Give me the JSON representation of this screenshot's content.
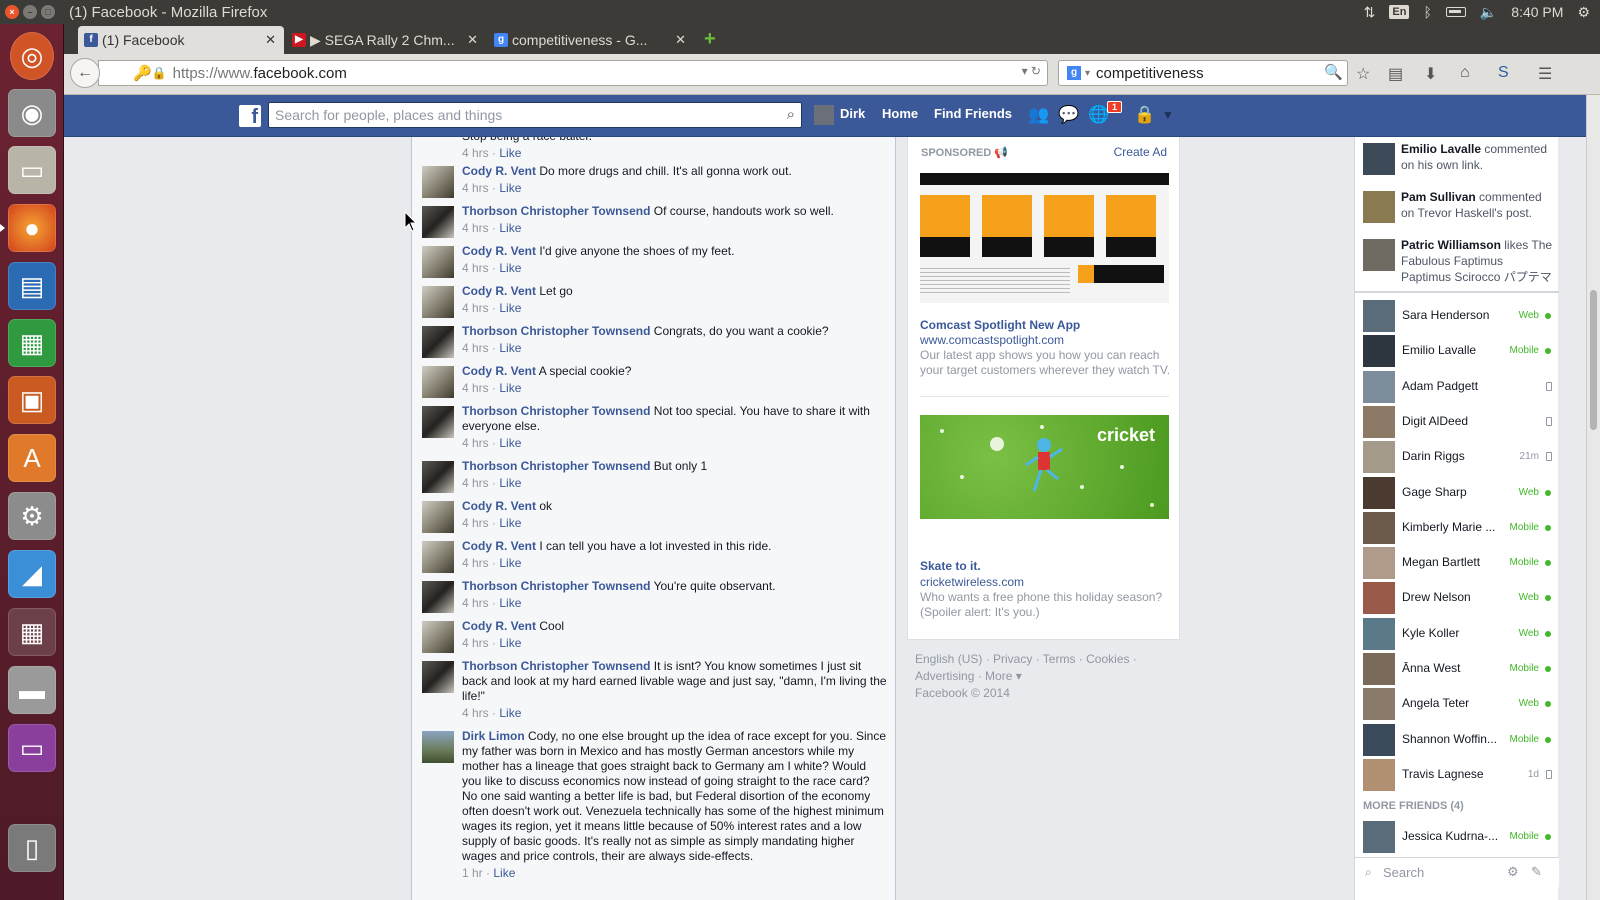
{
  "window": {
    "title": "(1) Facebook - Mozilla Firefox"
  },
  "tray": {
    "keyboard": "En",
    "time": "8:40 PM"
  },
  "tabs": [
    {
      "label": "(1) Facebook",
      "favicon": "facebook-icon",
      "color": "#3b5998"
    },
    {
      "label": "▶ SEGA Rally 2 Chm...",
      "favicon": "youtube-icon",
      "color": "#cc181e"
    },
    {
      "label": "competitiveness - G...",
      "favicon": "google-icon",
      "color": "#4285f4"
    }
  ],
  "navbar": {
    "url_prefix": "https://www.",
    "url_domain": "facebook.com",
    "search_value": "competitiveness"
  },
  "fb_header": {
    "search_placeholder": "Search for people, places and things",
    "user_name": "Dirk",
    "home": "Home",
    "find_friends": "Find Friends",
    "notification_count": "1"
  },
  "comments": [
    {
      "author": "",
      "text": "Stop being a race baiter.",
      "time": "4 hrs",
      "like": "Like",
      "avatar": "none"
    },
    {
      "author": "Cody R. Vent",
      "text": "Do more drugs and chill. It's all gonna work out.",
      "time": "4 hrs",
      "like": "Like",
      "avatar": "cody"
    },
    {
      "author": "Thorbson Christopher Townsend",
      "text": "Of course, handouts work so well.",
      "time": "4 hrs",
      "like": "Like",
      "avatar": "thor"
    },
    {
      "author": "Cody R. Vent",
      "text": "I'd give anyone the shoes of my feet.",
      "time": "4 hrs",
      "like": "Like",
      "avatar": "cody"
    },
    {
      "author": "Cody R. Vent",
      "text": "Let go",
      "time": "4 hrs",
      "like": "Like",
      "avatar": "cody"
    },
    {
      "author": "Thorbson Christopher Townsend",
      "text": "Congrats, do you want a cookie?",
      "time": "4 hrs",
      "like": "Like",
      "avatar": "thor"
    },
    {
      "author": "Cody R. Vent",
      "text": "A special cookie?",
      "time": "4 hrs",
      "like": "Like",
      "avatar": "cody"
    },
    {
      "author": "Thorbson Christopher Townsend",
      "text": "Not too special. You have to share it with everyone else.",
      "time": "4 hrs",
      "like": "Like",
      "avatar": "thor"
    },
    {
      "author": "Thorbson Christopher Townsend",
      "text": "But only 1",
      "time": "4 hrs",
      "like": "Like",
      "avatar": "thor"
    },
    {
      "author": "Cody R. Vent",
      "text": "ok",
      "time": "4 hrs",
      "like": "Like",
      "avatar": "cody"
    },
    {
      "author": "Cody R. Vent",
      "text": "I can tell you have a lot invested in this ride.",
      "time": "4 hrs",
      "like": "Like",
      "avatar": "cody"
    },
    {
      "author": "Thorbson Christopher Townsend",
      "text": "You're quite observant.",
      "time": "4 hrs",
      "like": "Like",
      "avatar": "thor"
    },
    {
      "author": "Cody R. Vent",
      "text": "Cool",
      "time": "4 hrs",
      "like": "Like",
      "avatar": "cody"
    },
    {
      "author": "Thorbson Christopher Townsend",
      "text": "It is isnt? You know sometimes I just sit back and look at my hard earned livable wage and just say, \"damn, I'm living the life!\"",
      "time": "4 hrs",
      "like": "Like",
      "avatar": "thor"
    },
    {
      "author": "Dirk Limon",
      "text": "Cody, no one else brought up the idea of race except for you. Since my father was born in Mexico and has mostly German ancestors while my mother has a lineage that goes straight back to Germany am I white? Would you like to discuss economics now instead of going straight to the race card? No one said wanting a better life is bad, but Federal disortion of the economy often doesn't work out. Venezuela technically has some of the highest minimum wages its region, yet it means little because of 50% interest rates and a low supply of basic goods. It's really not as simple as simply mandating higher wages and price controls, their are always side-effects.",
      "time": "1 hr",
      "like": "Like",
      "avatar": "dirk"
    }
  ],
  "ads": {
    "sponsored": "SPONSORED",
    "create_ad": "Create Ad",
    "ad1": {
      "title": "Comcast Spotlight New App",
      "url": "www.comcastspotlight.com",
      "desc": "Our latest app shows you how you can reach your target customers wherever they watch TV."
    },
    "ad2": {
      "brand": "cricket",
      "title": "Skate to it.",
      "url": "cricketwireless.com",
      "desc": "Who wants a free phone this holiday season? (Spoiler alert: It's you.)"
    }
  },
  "footer": {
    "line1": "English (US) · Privacy · Terms · Cookies ·",
    "line2": "Advertising · More ▾",
    "line3": "Facebook © 2014"
  },
  "ticker": [
    {
      "name": "Emilio Lavalle",
      "text": " commented on his own link."
    },
    {
      "name": "Pam Sullivan",
      "text": " commented on Trevor Haskell's post."
    },
    {
      "name": "Patric Williamson",
      "text": " likes The Fabulous Faptimus Paptimus Scirocco パプテマス・シロッコ's link."
    }
  ],
  "chat": [
    {
      "name": "Sara Henderson",
      "status": "Web",
      "kind": "online"
    },
    {
      "name": "Emilio Lavalle",
      "status": "Mobile",
      "kind": "online"
    },
    {
      "name": "Adam Padgett",
      "status": "",
      "kind": "phone"
    },
    {
      "name": "Digit AlDeed",
      "status": "",
      "kind": "phone"
    },
    {
      "name": "Darin Riggs",
      "status": "21m",
      "kind": "idle"
    },
    {
      "name": "Gage Sharp",
      "status": "Web",
      "kind": "online"
    },
    {
      "name": "Kimberly Marie ...",
      "status": "Mobile",
      "kind": "online"
    },
    {
      "name": "Megan Bartlett",
      "status": "Mobile",
      "kind": "online"
    },
    {
      "name": "Drew Nelson",
      "status": "Web",
      "kind": "online"
    },
    {
      "name": "Kyle Koller",
      "status": "Web",
      "kind": "online"
    },
    {
      "name": "Ānna West",
      "status": "Mobile",
      "kind": "online"
    },
    {
      "name": "Angela Teter",
      "status": "Web",
      "kind": "online"
    },
    {
      "name": "Shannon Woffin...",
      "status": "Mobile",
      "kind": "online"
    },
    {
      "name": "Travis Lagnese",
      "status": "1d",
      "kind": "idle"
    }
  ],
  "more_friends": "MORE FRIENDS (4)",
  "more_friends_list": [
    {
      "name": "Jessica Kudrna-...",
      "status": "Mobile",
      "kind": "online"
    }
  ],
  "chat_search_placeholder": "Search"
}
